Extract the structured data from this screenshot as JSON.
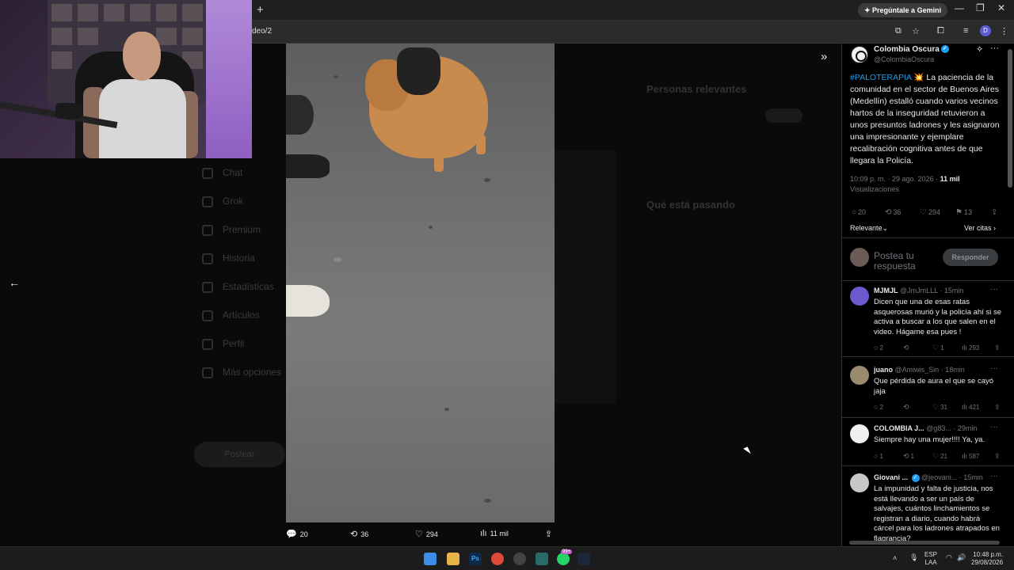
{
  "browser": {
    "new_tab_symbol": "+",
    "gemini_button": "Pregúntale a Gemini",
    "url_fragment": "deo/2",
    "profile_initial": "D",
    "window_controls": [
      "—",
      "❐",
      "✕"
    ]
  },
  "background_page": {
    "nav_items": [
      "Chat",
      "Grok",
      "Premium",
      "Historia",
      "Estadísticas",
      "Artículos",
      "Perfil",
      "Más opciones"
    ],
    "post_button": "Postear",
    "right_headings": [
      "Personas relevantes",
      "Qué está pasando"
    ]
  },
  "video_stats": {
    "replies": "20",
    "reposts": "36",
    "likes": "294",
    "views": "11 mil"
  },
  "tweet": {
    "author_name": "Colombia Oscura",
    "author_handle": "@ColombiaOscura",
    "hashtag": "#PALOTERAPIA",
    "emoji": "💥",
    "body": "La paciencia de la comunidad en el sector de Buenos Aires (Medellín) estalló cuando varios vecinos hartos de la inseguridad retuvieron a unos presuntos ladrones y les asignaron una impresionante y ejemplare recalibración cognitiva antes de que llegara la Policía.",
    "timestamp": "10:09 p. m. · 29 ago. 2026 ·",
    "views_count": "11 mil",
    "views_label": "Visualizaciones",
    "replies": "20",
    "reposts": "36",
    "likes": "294",
    "bookmarks": "13",
    "sort_label": "Relevante",
    "quotes_label": "Ver citas"
  },
  "composer": {
    "placeholder": "Postea tu respuesta",
    "reply_button": "Responder"
  },
  "replies": [
    {
      "name": "MJMJL",
      "handle": "@JmJmLLL",
      "time": "· 15min",
      "text": "Dicen que una de esas ratas asquerosas murió y la policía ahí si se activa a buscar a los que salen en el video. Hágame esa pues !",
      "replies": "2",
      "reposts": "",
      "likes": "1",
      "views": "293",
      "avatar_color": "#6a5acd"
    },
    {
      "name": "juano",
      "handle": "@Amiwis_Sin",
      "time": "· 18min",
      "text": "Que pérdida de aura el que se cayó jaja",
      "replies": "2",
      "reposts": "",
      "likes": "31",
      "views": "421",
      "avatar_color": "#9a8a70"
    },
    {
      "name": "COLOMBIA J...",
      "handle": "@g83...",
      "time": "· 29min",
      "text": "Siempre hay una mujer!!!! Ya, ya.",
      "replies": "1",
      "reposts": "1",
      "likes": "21",
      "views": "587",
      "avatar_color": "#ffffff"
    },
    {
      "name": "Giovani ...",
      "handle": "@jeovani...",
      "time": "· 15min",
      "text": "La impunidad y falta de justicia, nos está llevando a ser un país de salvajes, cuántos linchamientos se registran a diario, cuando habrá cárcel para los ladrones atrapados en flagrancia?",
      "replies": "",
      "reposts": "",
      "likes": "",
      "views": "",
      "avatar_color": "#c8c8c8"
    }
  ],
  "taskbar": {
    "language": "ESP",
    "layout": "LAA",
    "time": "10:48 p.m.",
    "date": "29/08/2026",
    "badge": "99+"
  }
}
